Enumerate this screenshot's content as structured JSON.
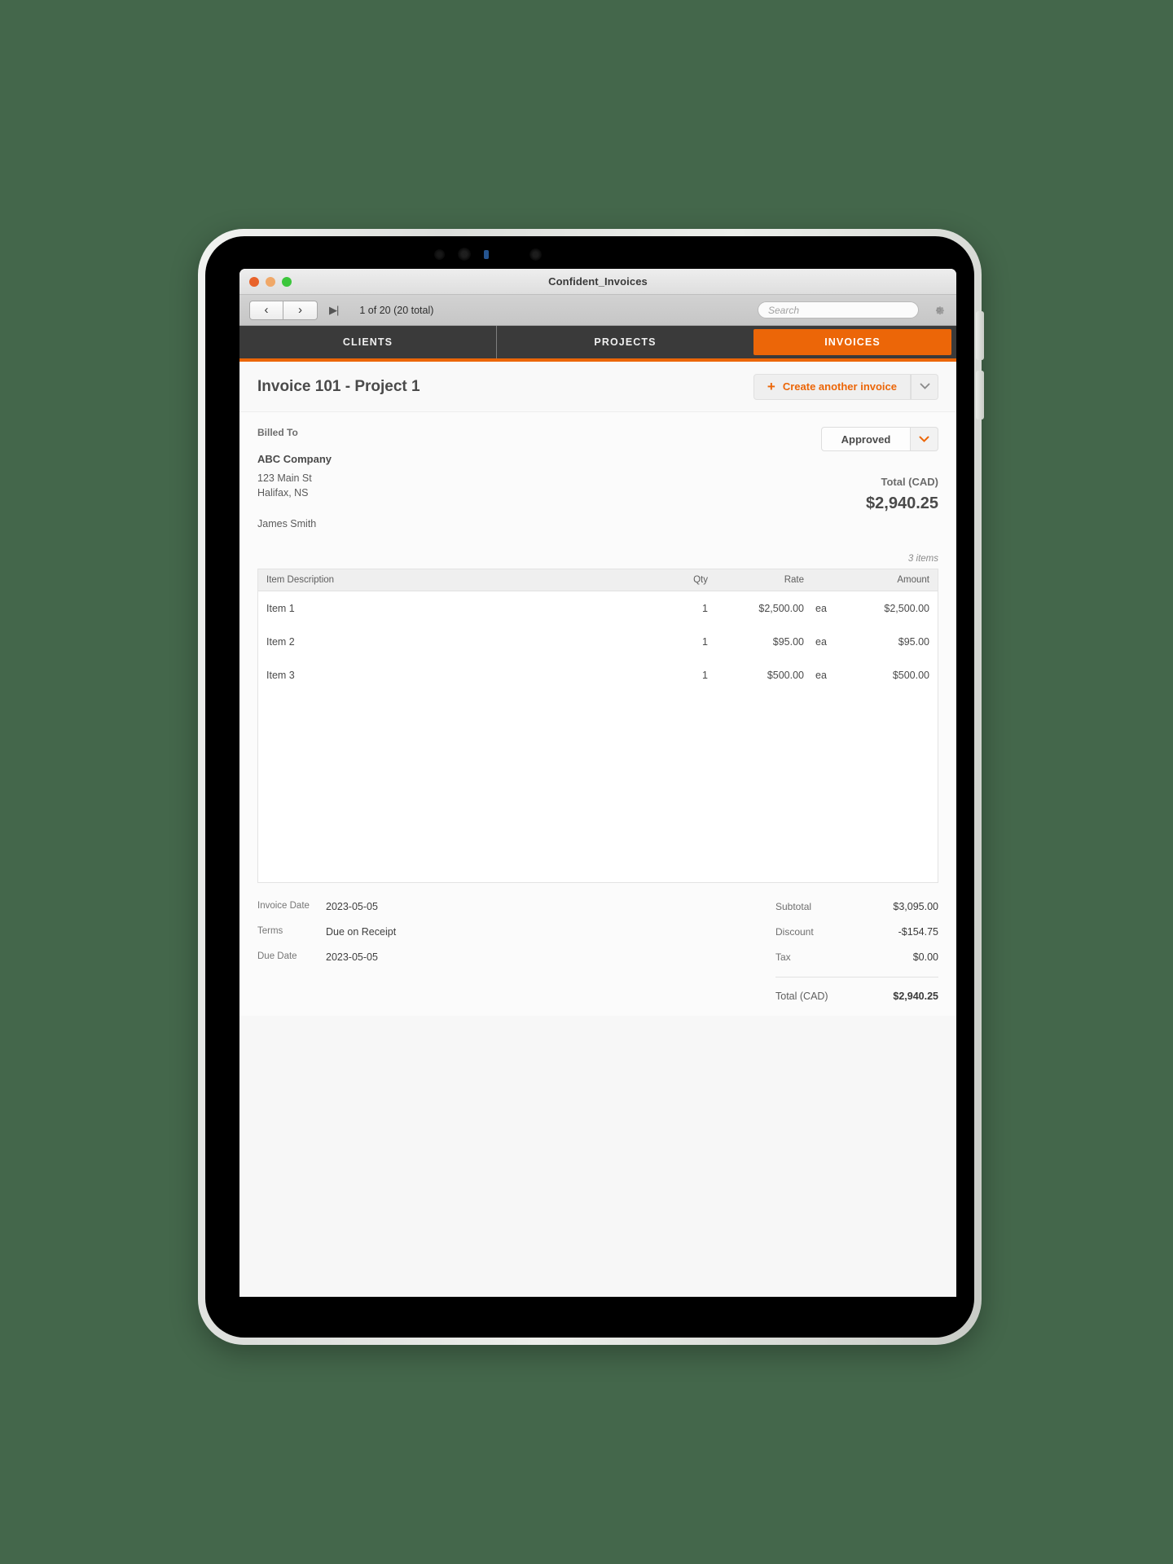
{
  "window": {
    "title": "Confident_Invoices",
    "traffic_lights": [
      "close",
      "minimize",
      "zoom"
    ]
  },
  "toolbar": {
    "prev_icon": "‹",
    "next_icon": "›",
    "last_record_icon": "▶|",
    "record_count": "1 of 20  (20 total)",
    "search_placeholder": "Search",
    "search_value": "",
    "gear_icon": "gear"
  },
  "tabs": [
    {
      "label": "CLIENTS",
      "active": false
    },
    {
      "label": "PROJECTS",
      "active": false
    },
    {
      "label": "INVOICES",
      "active": true
    }
  ],
  "header": {
    "title": "Invoice 101 - Project 1",
    "create_plus": "+",
    "create_label": "Create another invoice",
    "create_caret": "⌄"
  },
  "billed_to": {
    "label": "Billed To",
    "company": "ABC Company",
    "address_line1": "123 Main St",
    "address_line2": "Halifax, NS",
    "contact": "James Smith"
  },
  "status": {
    "value": "Approved",
    "caret": "⌄"
  },
  "total_top": {
    "label": "Total (CAD)",
    "amount": "$2,940.25"
  },
  "items": {
    "count_label": "3 items",
    "columns": {
      "description": "Item Description",
      "qty": "Qty",
      "rate": "Rate",
      "amount": "Amount"
    },
    "rows": [
      {
        "description": "Item 1",
        "qty": "1",
        "rate": "$2,500.00",
        "unit": "ea",
        "amount": "$2,500.00"
      },
      {
        "description": "Item 2",
        "qty": "1",
        "rate": "$95.00",
        "unit": "ea",
        "amount": "$95.00"
      },
      {
        "description": "Item 3",
        "qty": "1",
        "rate": "$500.00",
        "unit": "ea",
        "amount": "$500.00"
      }
    ]
  },
  "meta": {
    "invoice_date_label": "Invoice Date",
    "invoice_date": "2023-05-05",
    "terms_label": "Terms",
    "terms": "Due on Receipt",
    "due_date_label": "Due Date",
    "due_date": "2023-05-05"
  },
  "summary": {
    "subtotal_label": "Subtotal",
    "subtotal": "$3,095.00",
    "discount_label": "Discount",
    "discount": "-$154.75",
    "tax_label": "Tax",
    "tax": "$0.00",
    "total_label": "Total (CAD)",
    "total": "$2,940.25"
  },
  "colors": {
    "accent": "#ec6608",
    "nav_dark": "#3a3a3a",
    "page_bg": "#44674b"
  }
}
